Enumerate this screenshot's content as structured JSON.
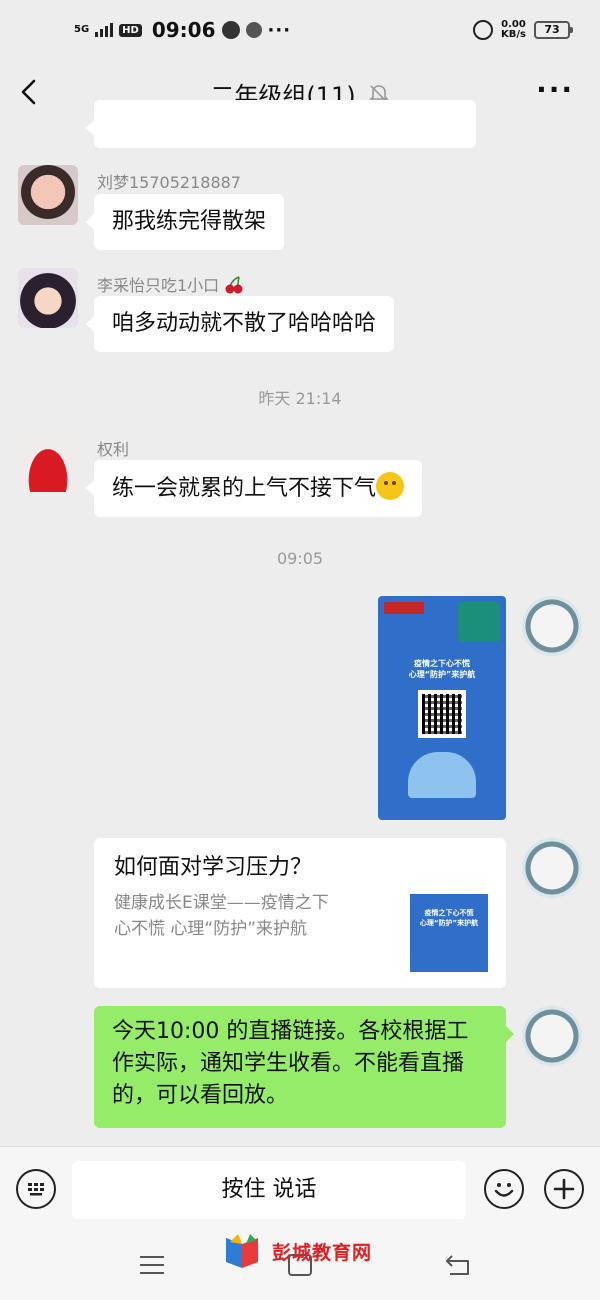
{
  "status_bar": {
    "network": "5G",
    "hd": "HD",
    "time": "09:06",
    "more": "···",
    "speed_value": "0.00",
    "speed_unit": "KB/s",
    "battery": "73"
  },
  "header": {
    "title": "二年级组(11)",
    "more": "···"
  },
  "messages": [
    {
      "sender": "刘梦15705218887",
      "text": "那我练完得散架"
    },
    {
      "sender": "李采怡只吃1小口",
      "sender_emoji": "cherries",
      "text": "咱多动动就不散了哈哈哈哈"
    },
    {
      "timestamp": "昨天 21:14"
    },
    {
      "sender": "权利",
      "text": "练一会就累的上气不接下气",
      "emoji": "thinking-face"
    },
    {
      "timestamp": "09:05"
    },
    {
      "type": "image",
      "from": "me",
      "content": {
        "poster_title": "疫情之下心不慌\n心理“防护”来护航"
      }
    },
    {
      "type": "link",
      "from": "me",
      "title": "如何面对学习压力？",
      "description": "健康成长E课堂——疫情之下\n心不慌 心理“防护”来护航",
      "thumb_text": "疫情之下心不慌\n心理“防护”来护航"
    },
    {
      "type": "text",
      "from": "me",
      "text": "今天10:00 的直播链接。各校根据工作实际，通知学生收看。不能看直播的，可以看回放。"
    }
  ],
  "input_bar": {
    "hold_to_talk": "按住 说话"
  },
  "watermark": {
    "text": "彭城教育网"
  },
  "colors": {
    "background": "#ededed",
    "my_bubble": "#95ec69",
    "watermark": "#e02020"
  }
}
